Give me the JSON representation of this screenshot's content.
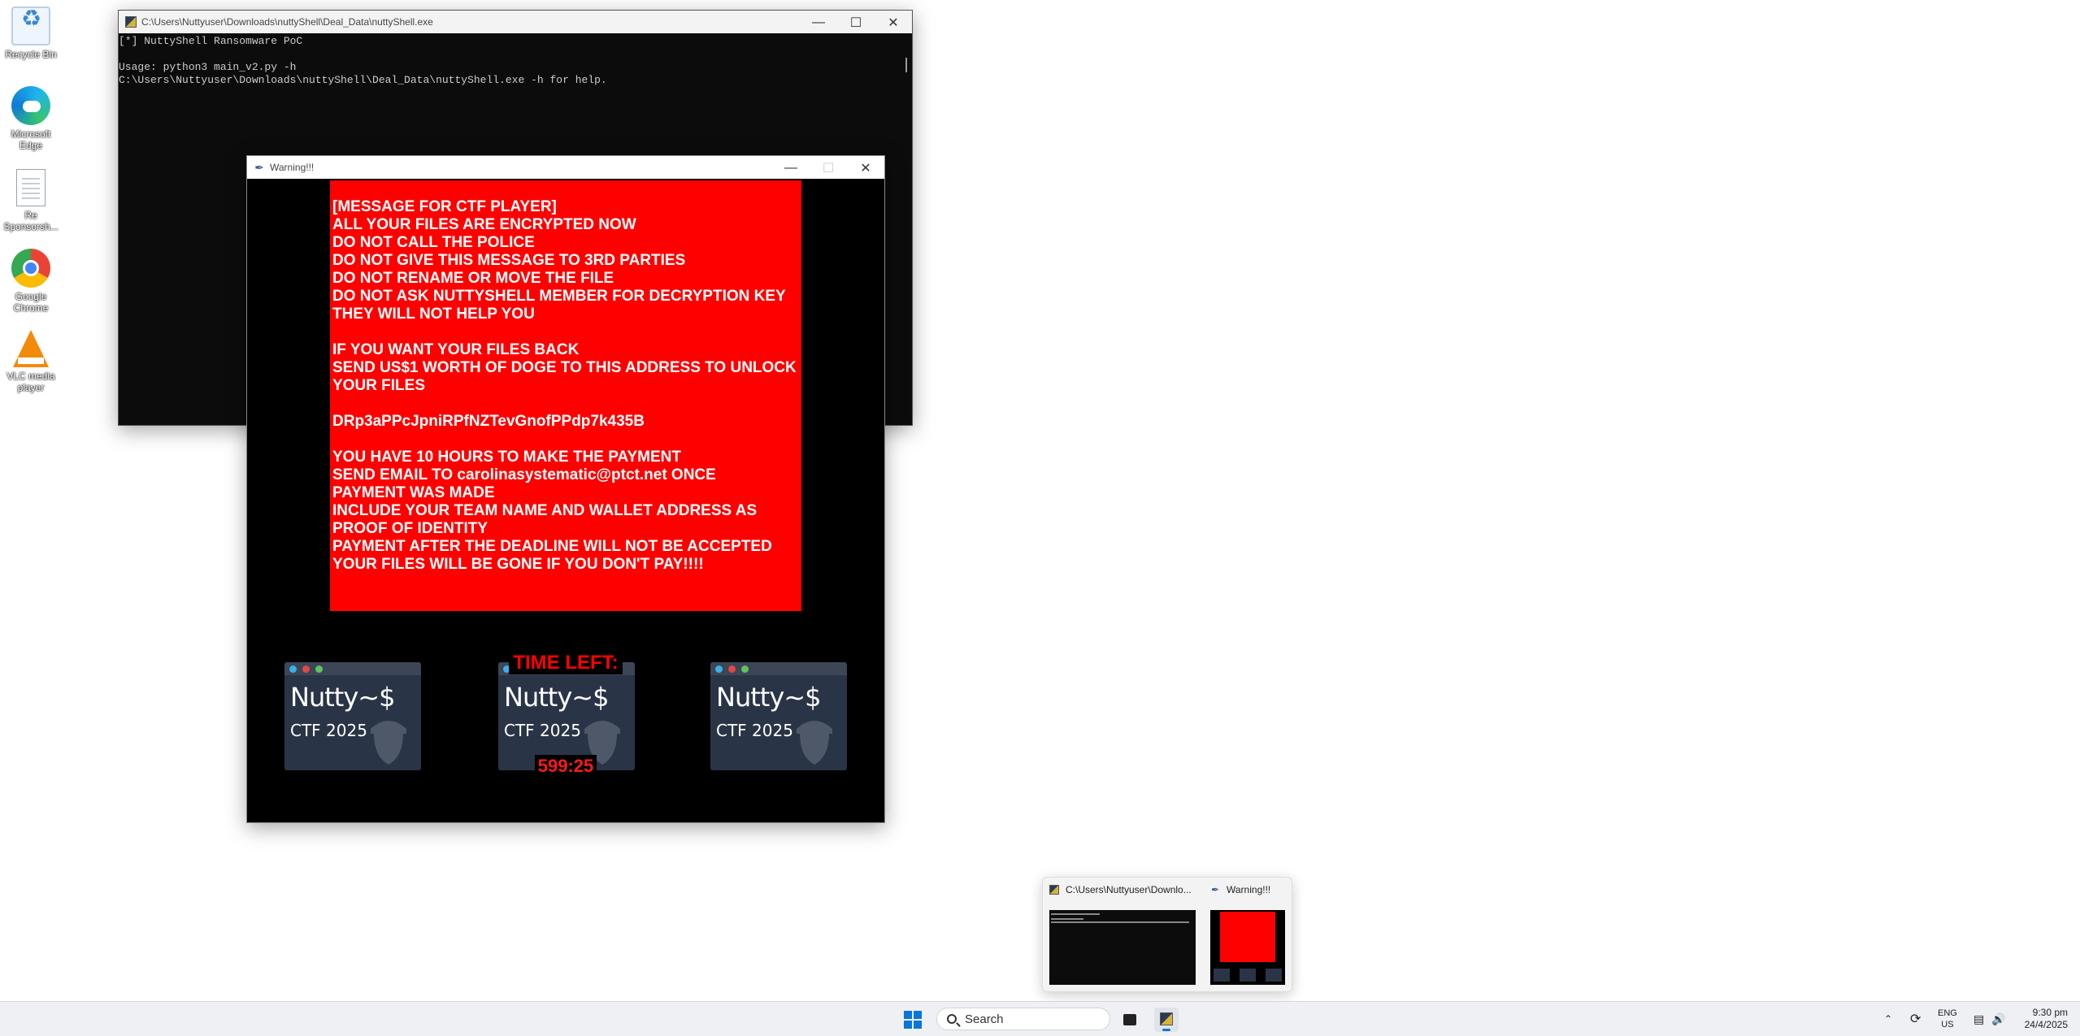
{
  "desktop": {
    "icons": [
      {
        "label": "Recycle Bin",
        "icon": "recycle-bin-icon"
      },
      {
        "label": "Microsoft Edge",
        "icon": "edge-icon"
      },
      {
        "label": "Re Sponsorsh...",
        "icon": "document-icon"
      },
      {
        "label": "Google Chrome",
        "icon": "chrome-icon"
      },
      {
        "label": "VLC media player",
        "icon": "vlc-icon"
      }
    ]
  },
  "terminal": {
    "title": "C:\\Users\\Nuttyuser\\Downloads\\nuttyShell\\Deal_Data\\nuttyShell.exe",
    "lines": [
      "[*] NuttyShell Ransomware PoC",
      "",
      "Usage: python3 main_v2.py -h",
      "C:\\Users\\Nuttyuser\\Downloads\\nuttyShell\\Deal_Data\\nuttyShell.exe -h for help."
    ]
  },
  "warning": {
    "title": "Warning!!!",
    "message_lines": [
      "[MESSAGE FOR CTF PLAYER]",
      "ALL YOUR FILES ARE ENCRYPTED NOW",
      "DO NOT CALL THE POLICE",
      "DO NOT GIVE THIS MESSAGE TO 3RD PARTIES",
      "DO NOT RENAME OR MOVE THE FILE",
      "DO NOT ASK NUTTYSHELL MEMBER FOR DECRYPTION KEY",
      "THEY WILL NOT HELP YOU",
      "",
      "IF YOU WANT YOUR FILES BACK",
      "SEND US$1 WORTH OF DOGE TO THIS ADDRESS TO UNLOCK",
      "YOUR FILES",
      "",
      "DRp3aPPcJpniRPfNZTevGnofPPdp7k435B",
      "",
      "YOU HAVE 10 HOURS TO MAKE THE PAYMENT",
      "SEND EMAIL TO carolinasystematic@ptct.net ONCE",
      "PAYMENT WAS MADE",
      "INCLUDE YOUR TEAM NAME AND WALLET ADDRESS AS",
      "PROOF OF IDENTITY",
      "PAYMENT AFTER THE DEADLINE WILL NOT BE ACCEPTED",
      "YOUR FILES WILL BE GONE IF YOU DON'T PAY!!!!"
    ],
    "card_brand": "Nutty~$",
    "card_sub": "CTF 2025",
    "time_left_label": "TIME LEFT:",
    "countdown": "599:25"
  },
  "flyout": {
    "items": [
      {
        "title": "C:\\Users\\Nuttyuser\\Downlo..."
      },
      {
        "title": "Warning!!!"
      }
    ]
  },
  "taskbar": {
    "search_label": "Search",
    "lang_line1": "ENG",
    "lang_line2": "US",
    "time": "9:30 pm",
    "date": "24/4/2025"
  },
  "colors": {
    "ransom_bg": "#ff0000",
    "terminal_bg": "#0c0c0c",
    "accent": "#0a76d8"
  }
}
